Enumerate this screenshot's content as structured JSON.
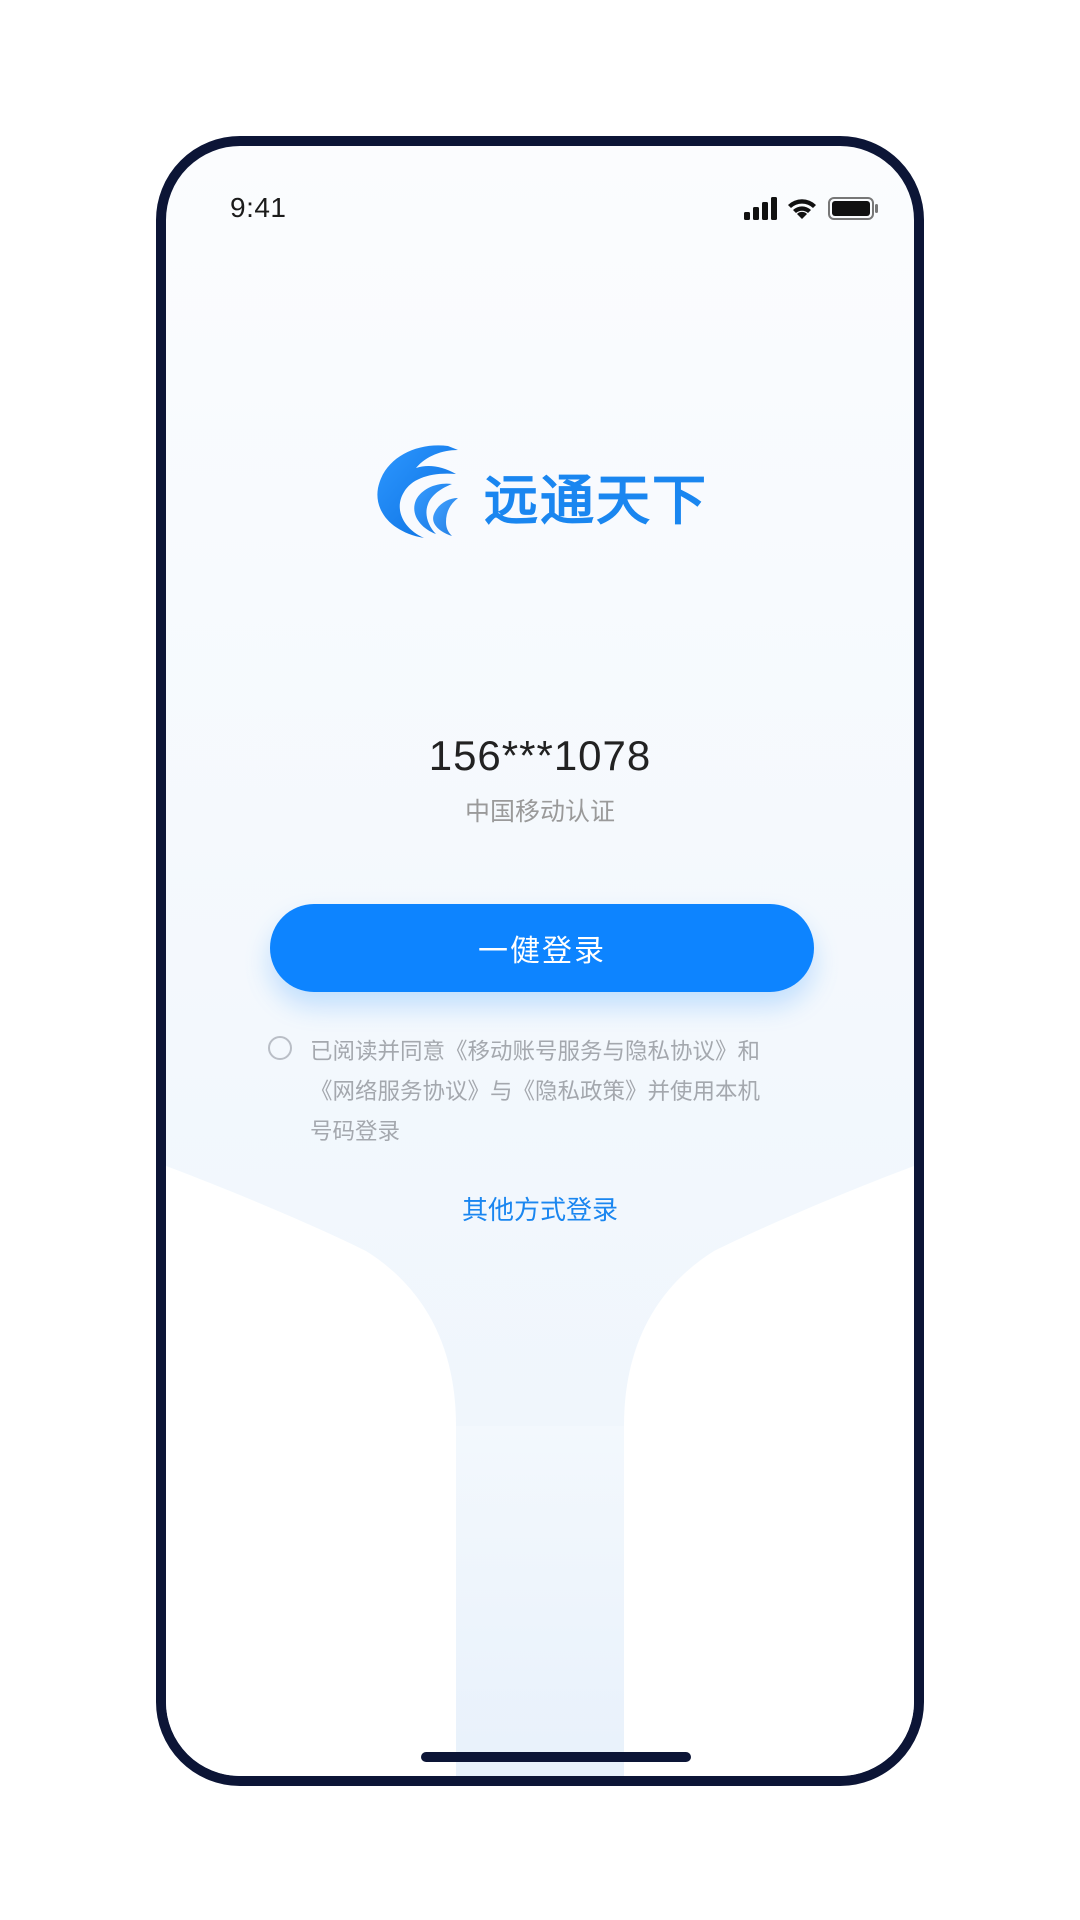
{
  "status_bar": {
    "time": "9:41",
    "icons": [
      "signal-icon",
      "wifi-icon",
      "battery-icon"
    ]
  },
  "brand": {
    "name": "远通天下",
    "color": "#1a86f0"
  },
  "account": {
    "phone_number": "156***1078",
    "carrier_label": "中国移动认证"
  },
  "login": {
    "button_label": "一健登录",
    "button_color": "#0d84ff"
  },
  "agreement": {
    "checked": false,
    "lines": [
      "已阅读并同意《移动账号服务与隐私协议》和",
      "《网络服务协议》与《隐私政策》并使用本机",
      "号码登录"
    ]
  },
  "other_login": {
    "label": "其他方式登录"
  },
  "colors": {
    "frame": "#0c1536",
    "accent": "#1a86f0"
  }
}
